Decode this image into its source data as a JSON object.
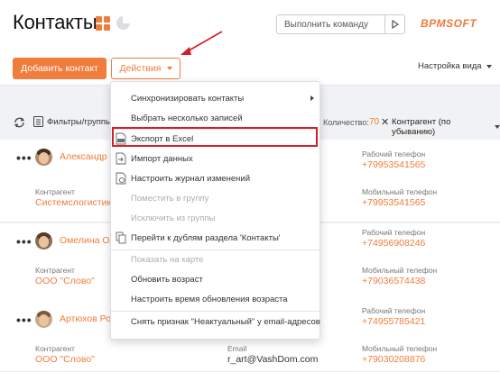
{
  "header": {
    "title": "Контакты",
    "command_placeholder": "Выполнить команду",
    "logo": "BPMSOFT",
    "add_button": "Добавить контакт",
    "actions_button": "Действия",
    "view_settings": "Настройка вида"
  },
  "toolbar": {
    "filters": "Фильтры/группы",
    "count_label": "Количество:",
    "count_value": "70",
    "sort": "Контрагент (по убыванию)"
  },
  "menu": {
    "items": [
      {
        "label": "Синхронизировать контакты",
        "enabled": true,
        "submenu": true
      },
      {
        "label": "Выбрать несколько записей",
        "enabled": true
      },
      {
        "label": "Экспорт в Excel",
        "enabled": true,
        "icon": "excel-icon",
        "highlighted": true
      },
      {
        "label": "Импорт данных",
        "enabled": true,
        "icon": "import-icon"
      },
      {
        "label": "Настроить журнал изменений",
        "enabled": true,
        "icon": "changelog-icon"
      },
      {
        "label": "Поместить в группу",
        "enabled": false
      },
      {
        "label": "Исключить из группы",
        "enabled": false
      },
      {
        "label": "Перейти к дублям раздела 'Контакты'",
        "enabled": true,
        "icon": "duplicates-icon"
      },
      {
        "label": "Показать на карте",
        "enabled": false
      },
      {
        "label": "Обновить возраст",
        "enabled": true
      },
      {
        "label": "Настроить время обновления возраста",
        "enabled": true
      },
      {
        "label": "Снять признак \"Неактуальный\" у email-адресов",
        "enabled": true
      }
    ]
  },
  "rows": [
    {
      "name": "Александр Ни",
      "account_label": "Контрагент",
      "account": "Системслогистик",
      "work_phone_label": "Рабочий телефон",
      "work_phone": "+79953541565",
      "mobile_label": "Мобильный телефон",
      "mobile": "+79953541565"
    },
    {
      "name": "Омелина Ольг",
      "account_label": "Контрагент",
      "account": "ООО \"Слово\"",
      "work_phone_label": "Рабочий телефон",
      "work_phone": "+74956908246",
      "mobile_label": "Мобильный телефон",
      "mobile": "+79036574438"
    },
    {
      "name": "Артюхов Ром",
      "account_label": "Контрагент",
      "account": "ООО \"Слово\"",
      "email_label": "Email",
      "email": "r_art@VashDom.com",
      "work_phone_label": "Рабочий телефон",
      "work_phone": "+74955785421",
      "mobile_label": "Мобильный телефон",
      "mobile": "+79030208876"
    }
  ],
  "colors": {
    "accent": "#f07d3c",
    "highlight": "#d31f27"
  }
}
